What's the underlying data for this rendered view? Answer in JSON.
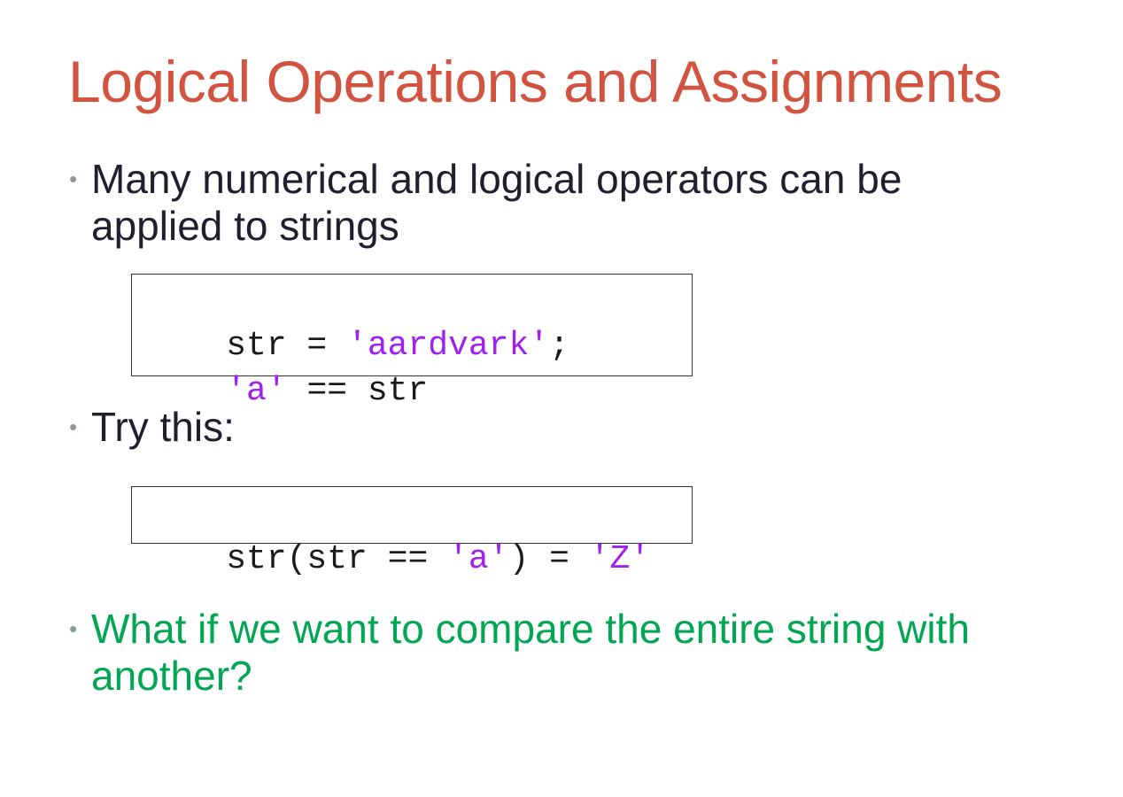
{
  "colors": {
    "title": "#D2533F",
    "body_text": "#1F1F2E",
    "bullet_dot": "#8A9A9A",
    "code_text": "#1A1A1A",
    "string_literal": "#A020F0",
    "highlight_bullet": "#00A651"
  },
  "slide": {
    "title": "Logical Operations and Assignments",
    "bullets": [
      {
        "dot": "•",
        "lines": [
          "Many numerical and logical operators can be",
          "applied to strings"
        ]
      },
      {
        "dot": "•",
        "lines": [
          "Try this:"
        ]
      },
      {
        "dot": "•",
        "lines": [
          "What if we want to compare the entire string with",
          "another?"
        ]
      }
    ],
    "code_blocks": [
      {
        "lines": [
          [
            {
              "text": "str = ",
              "kind": "code"
            },
            {
              "text": "'aardvark'",
              "kind": "string"
            },
            {
              "text": ";",
              "kind": "code"
            }
          ],
          [
            {
              "text": "'a'",
              "kind": "string"
            },
            {
              "text": " == str",
              "kind": "code"
            }
          ]
        ]
      },
      {
        "lines": [
          [
            {
              "text": "str(str == ",
              "kind": "code"
            },
            {
              "text": "'a'",
              "kind": "string"
            },
            {
              "text": ") = ",
              "kind": "code"
            },
            {
              "text": "'Z'",
              "kind": "string"
            }
          ]
        ]
      }
    ]
  }
}
